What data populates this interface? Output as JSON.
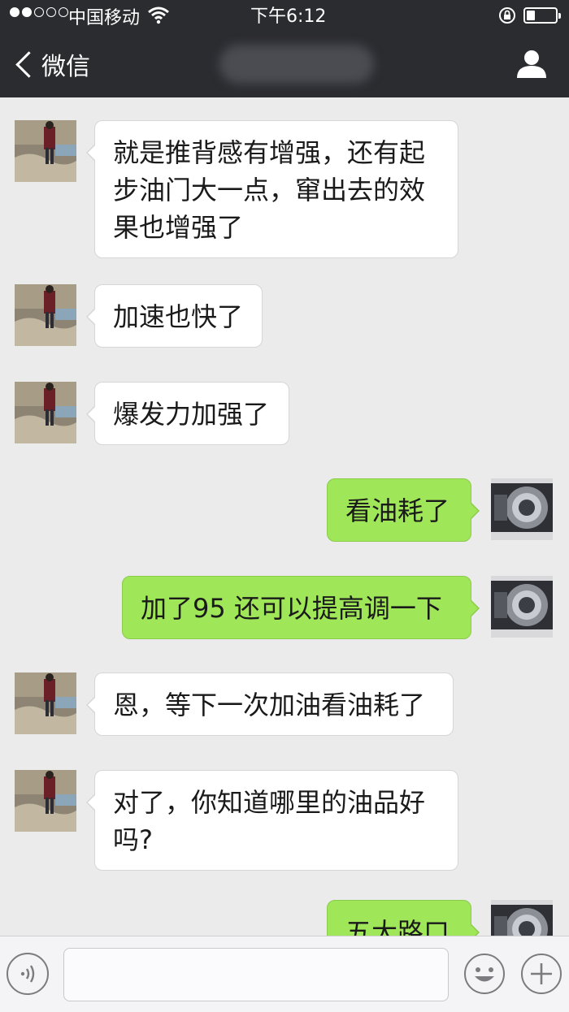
{
  "status_bar": {
    "carrier": "中国移动",
    "time": "下午6:12",
    "signal_bars_filled": 2,
    "signal_bars_total": 5
  },
  "nav": {
    "back_label": "微信"
  },
  "colors": {
    "nav_background": "#2b2c30",
    "chat_background": "#ebebeb",
    "incoming_bubble": "#ffffff",
    "outgoing_bubble": "#9fe658"
  },
  "messages": [
    {
      "side": "in",
      "text": "就是推背感有增强，还有起\n步油门大一点，窜出去的效\n果也增强了"
    },
    {
      "side": "in",
      "text": "加速也快了"
    },
    {
      "side": "in",
      "text": "爆发力加强了"
    },
    {
      "side": "out",
      "text": "看油耗了"
    },
    {
      "side": "out",
      "text": "加了95 还可以提高调一下"
    },
    {
      "side": "in",
      "text": "恩，等下一次加油看油耗了"
    },
    {
      "side": "in",
      "text": "对了，你知道哪里的油品好\n吗?"
    },
    {
      "side": "out",
      "text": "五大路口"
    }
  ],
  "input_bar": {
    "voice_icon": "voice-icon",
    "emoji_icon": "emoji-icon",
    "plus_icon": "plus-icon",
    "text_value": ""
  }
}
